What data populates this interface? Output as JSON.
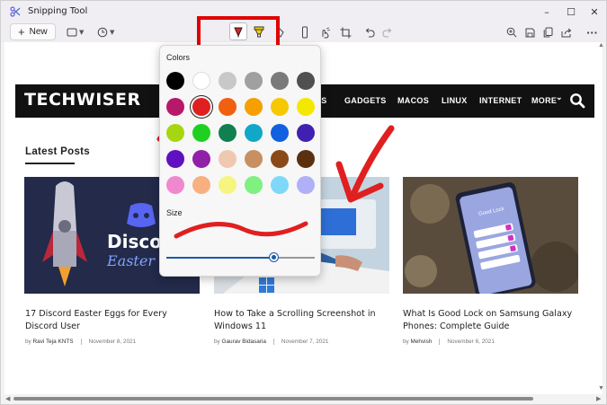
{
  "window": {
    "title": "Snipping Tool",
    "controls": [
      "–",
      "☐",
      "✕"
    ]
  },
  "toolbar": {
    "new_label": "New",
    "more_label": "···",
    "accent_highlight_color": "#e00000",
    "pen_color": "#e02020",
    "highlighter_color": "#f5d000"
  },
  "website": {
    "logo": "TECHWISER",
    "nav": {
      "partial_item": "OS",
      "items": [
        "GADGETS",
        "MACOS",
        "LINUX",
        "INTERNET",
        "MORE"
      ],
      "more_caret": "⌄"
    },
    "section_title": "Latest Posts",
    "posts": [
      {
        "title": "17 Discord Easter Eggs for Every Discord User",
        "author_prefix": "by",
        "author": "Ravi Teja KNTS",
        "date": "November 8, 2021",
        "thumb_text_1": "Discord",
        "thumb_text_2": "Easter"
      },
      {
        "title": "How to Take a Scrolling Screenshot in Windows 11",
        "author_prefix": "by",
        "author": "Gaurav Bidasaria",
        "date": "November 7, 2021"
      },
      {
        "title": "What Is Good Lock on Samsung Galaxy Phones: Complete Guide",
        "author_prefix": "by",
        "author": "Mehvish",
        "date": "November 6, 2021",
        "thumb_text_1": "Good Lock"
      }
    ]
  },
  "color_popup": {
    "colors_label": "Colors",
    "size_label": "Size",
    "selected_color": "#e02020",
    "size_fraction": 0.73,
    "swatches": [
      "#000000",
      "#ffffff",
      "#c8c8c8",
      "#a0a0a0",
      "#7a7a7a",
      "#505050",
      "#b8186a",
      "#e02020",
      "#f06010",
      "#f5a000",
      "#f5c800",
      "#f5e800",
      "#a6d610",
      "#20d020",
      "#108050",
      "#10a8c8",
      "#1060e0",
      "#4020b0",
      "#6010c0",
      "#9020a8",
      "#f0c8b0",
      "#c89060",
      "#8a4a18",
      "#5a3010",
      "#f088d0",
      "#f8b080",
      "#f5f580",
      "#80f080",
      "#80d8f8",
      "#b0b0f8"
    ]
  }
}
